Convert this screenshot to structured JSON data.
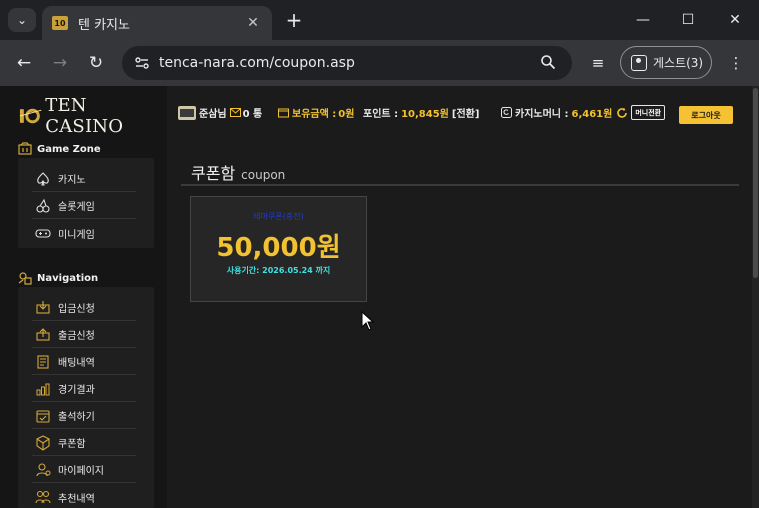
{
  "browser": {
    "tab_title": "텐 카지노",
    "favicon_text": "10",
    "url": "tenca-nara.com/coupon.asp",
    "guest_label": "게스트(3)",
    "tab_dropdown_glyph": "⌄",
    "close_glyph": "✕",
    "newtab_glyph": "+",
    "minimize_glyph": "—",
    "maximize_glyph": "☐",
    "window_close_glyph": "✕",
    "back_glyph": "←",
    "forward_glyph": "→",
    "reload_glyph": "↻",
    "menu_glyph": "⋮",
    "playlist_glyph": "≡",
    "icons": [
      "tab-search-icon",
      "close-icon",
      "new-tab-icon",
      "minimize-icon",
      "maximize-icon",
      "window-close-icon",
      "back-icon",
      "forward-icon",
      "reload-icon",
      "site-info-icon",
      "search-icon",
      "reading-list-icon",
      "guest-profile-icon",
      "menu-icon"
    ]
  },
  "site": {
    "logo": "TEN CASINO",
    "sidebar": {
      "game_zone_title": "Game Zone",
      "game_zone_items": [
        {
          "label": "카지노",
          "icon": "spade-icon"
        },
        {
          "label": "슬롯게임",
          "icon": "cherry-icon"
        },
        {
          "label": "미니게임",
          "icon": "gamepad-icon"
        }
      ],
      "navigation_title": "Navigation",
      "navigation_items": [
        {
          "label": "입금신청",
          "icon": "deposit-icon"
        },
        {
          "label": "출금신청",
          "icon": "withdraw-icon"
        },
        {
          "label": "배팅내역",
          "icon": "bet-history-icon"
        },
        {
          "label": "경기결과",
          "icon": "results-icon"
        },
        {
          "label": "출석하기",
          "icon": "attendance-icon"
        },
        {
          "label": "쿠폰함",
          "icon": "coupon-icon"
        },
        {
          "label": "마이페이지",
          "icon": "mypage-icon"
        },
        {
          "label": "추천내역",
          "icon": "referral-icon"
        }
      ]
    },
    "topbar": {
      "username": "준삼님",
      "messages": "0 통",
      "holding_label": "보유금액 :",
      "holding_value": "0원",
      "points_label": "포인트 :",
      "points_value": "10,845원",
      "points_convert": "[전환]",
      "casino_money_label": "카지노머니 :",
      "casino_money_value": "6,461원",
      "mini_exchange": "머니전환",
      "logout": "로그아웃"
    },
    "page": {
      "title_ko": "쿠폰함",
      "title_en": "coupon"
    },
    "coupons": [
      {
        "name": "테마쿠폰(충전)",
        "amount": "50,000원",
        "expiry": "사용기간: 2026.05.24 까지"
      }
    ],
    "colors": {
      "accent": "#f2c230",
      "coupon_name": "#1f3bd6",
      "expiry": "#3fe0e0",
      "sidebar_bg": "#151515",
      "content_bg": "#1b1b1b"
    }
  }
}
